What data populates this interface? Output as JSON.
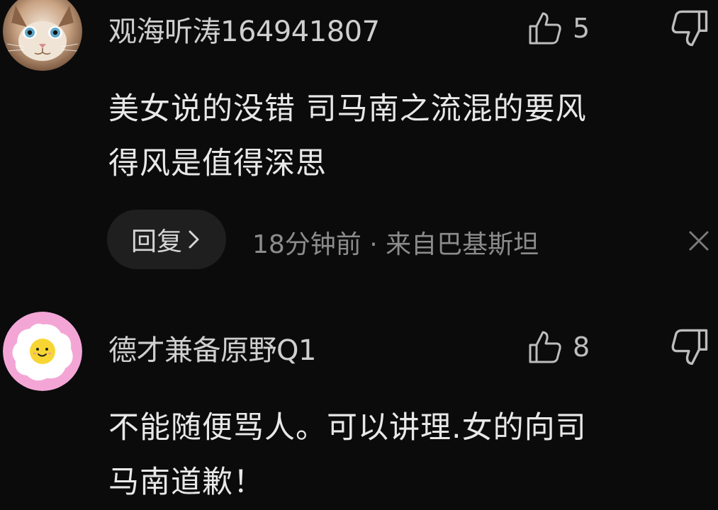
{
  "comments": [
    {
      "username": "观海听涛164941807",
      "likes": "5",
      "text_line1": "美女说的没错 司马南之流混的要风",
      "text_line2": "得风是值得深思",
      "reply_label": "回复",
      "meta": "18分钟前 · 来自巴基斯坦",
      "avatar": "cat-avatar"
    },
    {
      "username": "德才兼备原野Q1",
      "likes": "8",
      "text_line1": "不能随便骂人。可以讲理.女的向司",
      "text_line2": "马南道歉！",
      "avatar": "fried-egg-avatar"
    }
  ],
  "icons": {
    "like": "thumbs-up-icon",
    "dislike": "thumbs-down-icon",
    "reply_chevron": "chevron-right-icon",
    "close": "close-icon"
  },
  "colors": {
    "background": "#0b0b0b",
    "reply_pill": "#1f1f1f",
    "egg_ring": "#f3a6d6",
    "egg_yolk": "#f7d634"
  }
}
